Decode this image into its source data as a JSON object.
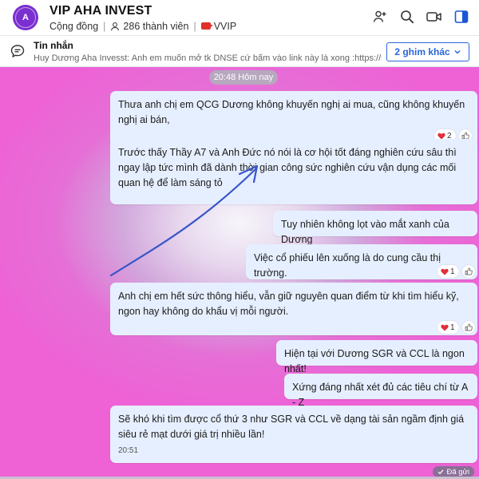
{
  "header": {
    "avatar_letter": "A",
    "title": "VIP AHA INVEST",
    "category": "Cộng đồng",
    "members": "286 thành viên",
    "tag": "VVIP"
  },
  "pinned": {
    "title": "Tin nhắn",
    "text": "Huy Dương Aha Invesst: Anh em muốn mở tk DNSE cứ bấm vào link này là xong :https://s.dnse.vn/...",
    "more_button": "2 ghim khác"
  },
  "chat": {
    "time_chip": "20:48 Hôm nay",
    "messages": [
      {
        "text": "Thưa anh chị em QCG Dương không khuyến nghị ai mua, cũng không khuyến nghị ai bán,",
        "reaction_count": "2"
      },
      {
        "text": "Trước thấy Thầy A7 và Anh Đức nó nói là cơ hội tốt đáng nghiên cứu sâu thì ngay lập tức mình đã dành thời gian công sức nghiên cứu vận dụng các mối quan hệ để làm sáng tỏ"
      },
      {
        "text": "Tuy nhiên không lọt vào mắt xanh của Dương"
      },
      {
        "text": "Việc cổ phiếu lên xuống là do cung cầu thị trường.",
        "reaction_count": "1"
      },
      {
        "text": "Anh chị em hết sức thông hiểu, vẫn giữ nguyên quan điểm từ khi tìm hiểu kỹ, ngon hay không do khẩu vị mỗi người.",
        "reaction_count": "1"
      },
      {
        "text": "Hiện tại với Dương SGR và CCL là ngon nhất!"
      },
      {
        "text": "Xứng đáng nhất xét đủ các tiêu chí từ A - Z"
      },
      {
        "text": "Sẽ khó khi tìm được cổ thứ 3 như SGR và CCL về dạng tài sản ngầm định giá siêu rẻ mạt dưới giá trị nhiều lần!",
        "time": "20:51"
      }
    ],
    "sent_status": "Đã gửi"
  },
  "colors": {
    "bubble": "#e6efff",
    "accent": "#2b66d9",
    "avatar": "#7a2fd0",
    "arrow": "#3a56c8"
  }
}
